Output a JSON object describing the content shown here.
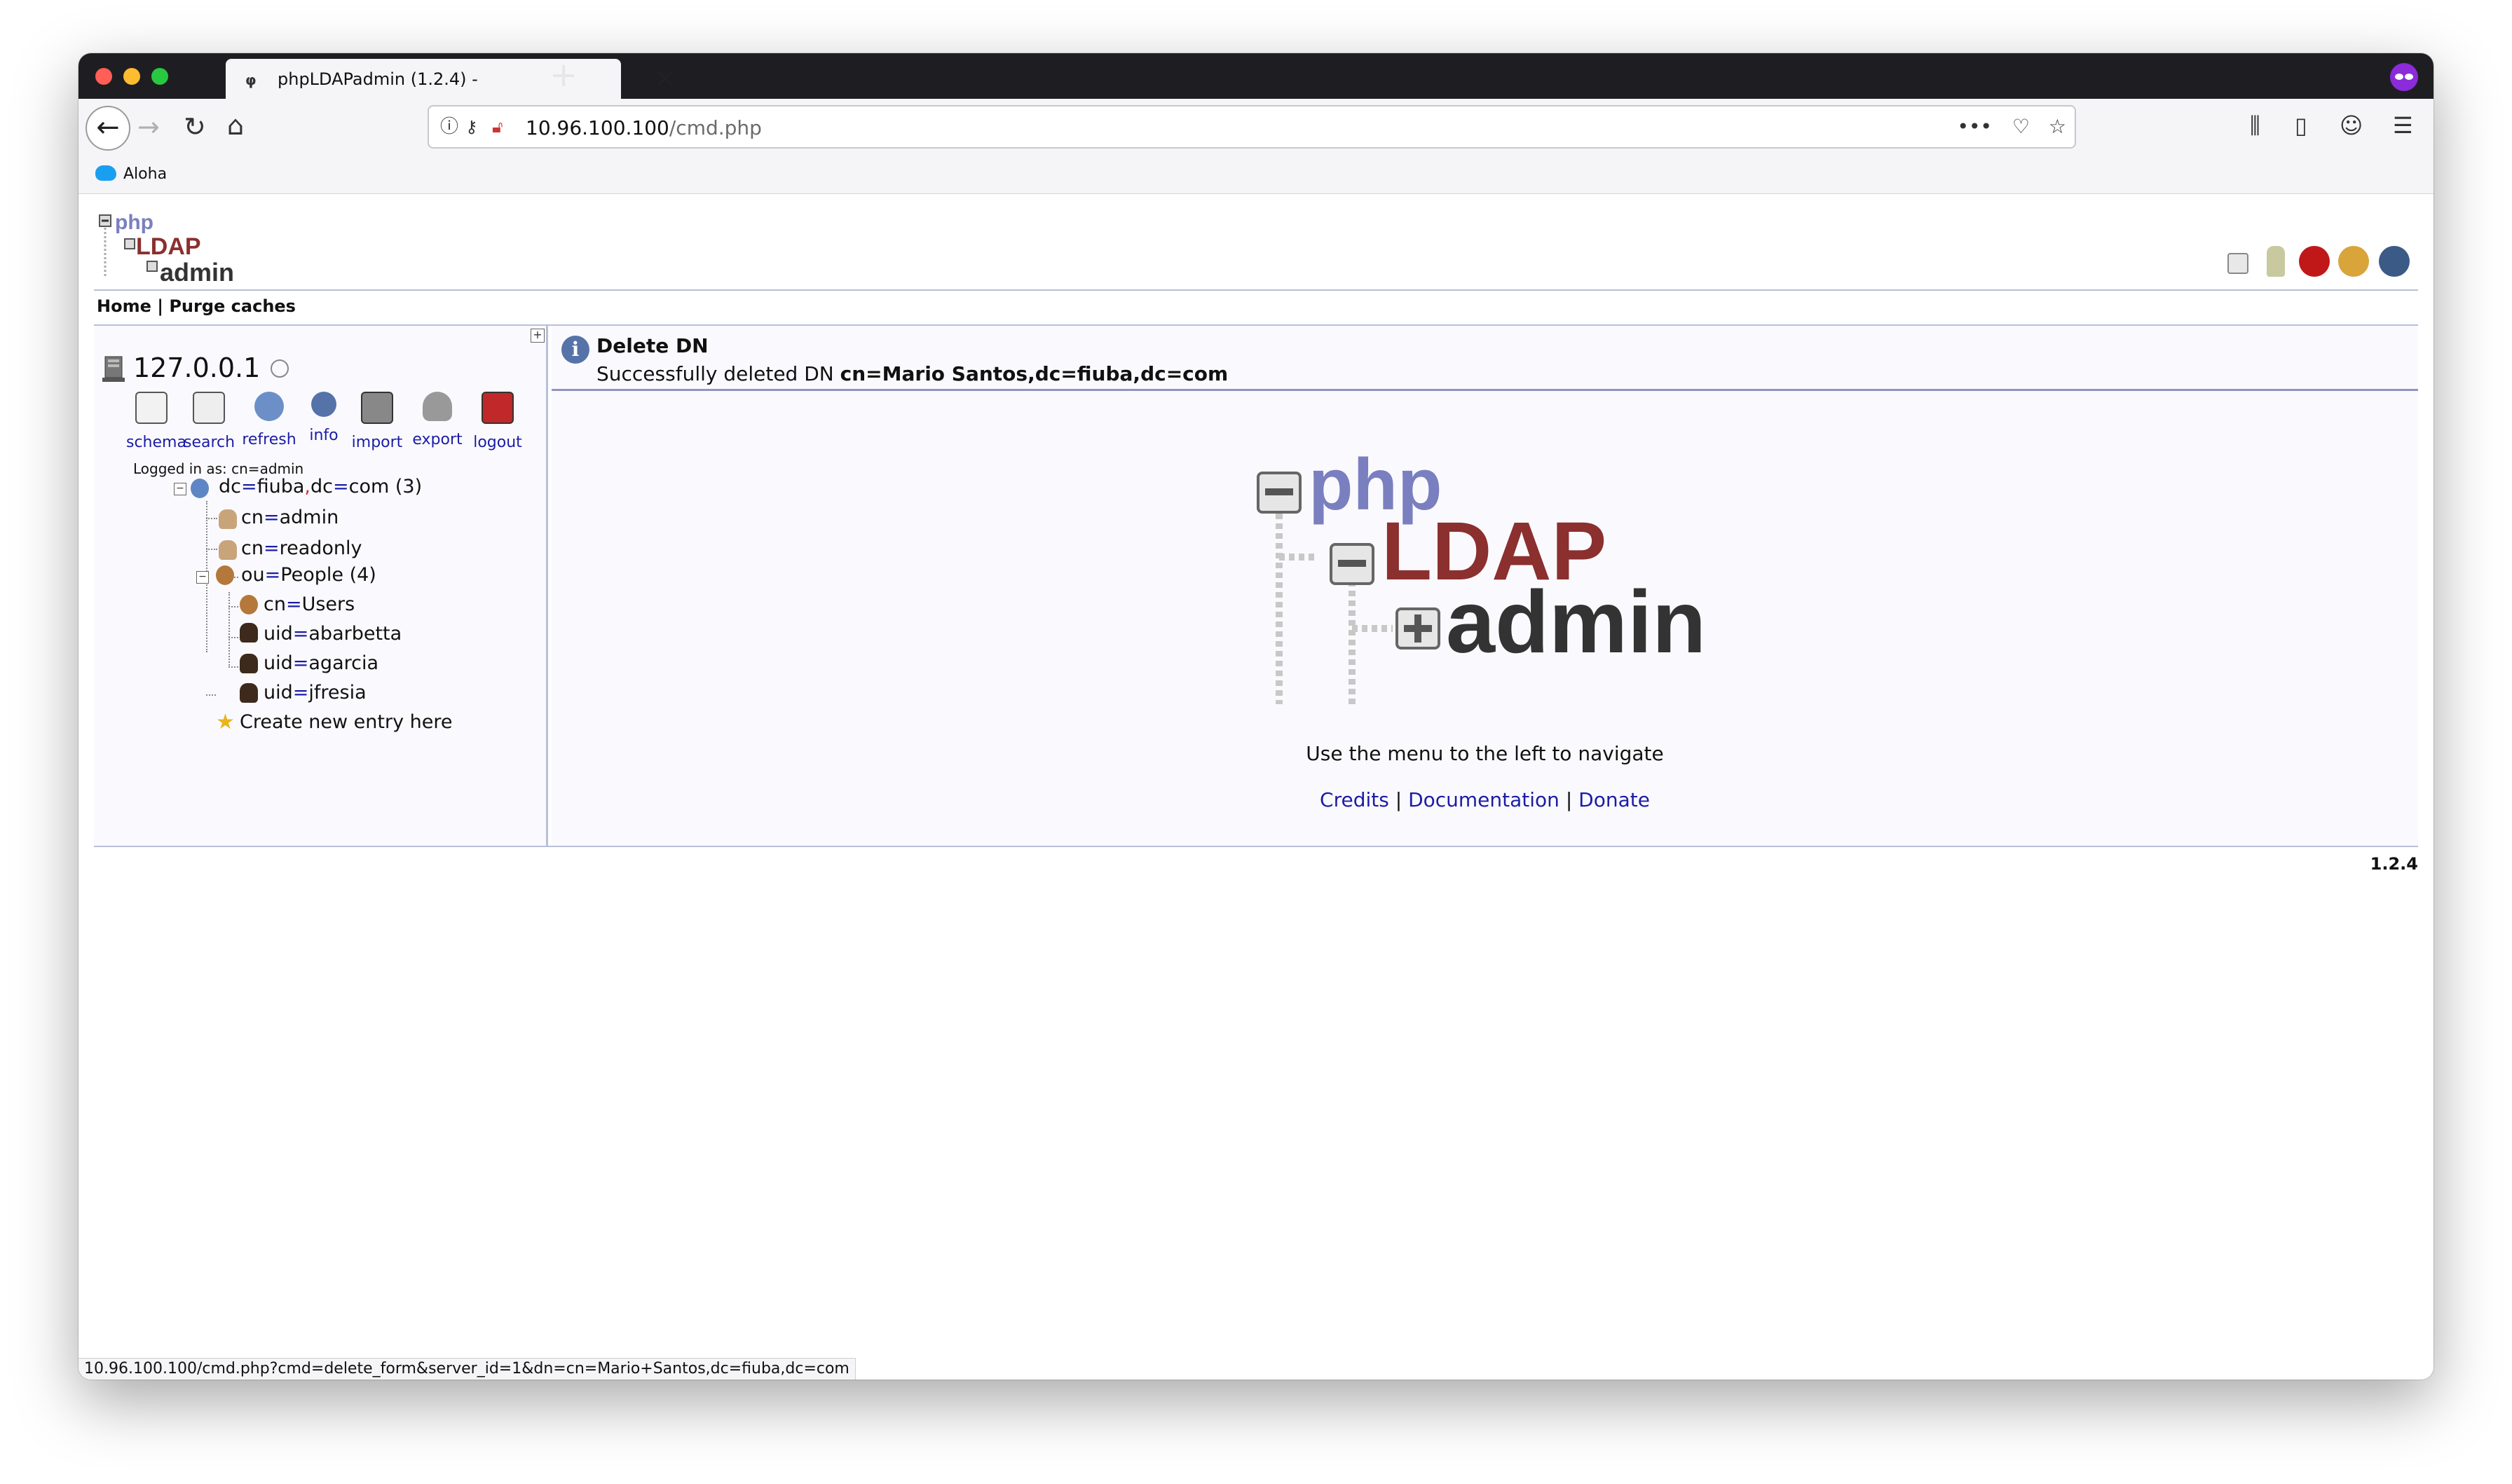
{
  "browser": {
    "tab_title": "phpLDAPadmin (1.2.4) -",
    "url_host": "10.96.100.100",
    "url_path": "/cmd.php",
    "bookmark_label": "Aloha",
    "status_url": "10.96.100.100/cmd.php?cmd=delete_form&server_id=1&dn=cn=Mario+Santos,dc=fiuba,dc=com"
  },
  "app": {
    "logo_text": "phpLDAPadmin",
    "breadcrumbs": {
      "home": "Home",
      "separator": "|",
      "purge": "Purge caches"
    }
  },
  "tree": {
    "server_name": "127.0.0.1",
    "tools": [
      {
        "label": "schema",
        "icon": "schema-icon"
      },
      {
        "label": "search",
        "icon": "search-icon"
      },
      {
        "label": "refresh",
        "icon": "refresh-icon"
      },
      {
        "label": "info",
        "icon": "info-icon"
      },
      {
        "label": "import",
        "icon": "import-icon"
      },
      {
        "label": "export",
        "icon": "export-icon"
      },
      {
        "label": "logout",
        "icon": "logout-icon"
      }
    ],
    "logged_in_as": "Logged in as: cn=admin",
    "root": {
      "k1": "dc",
      "v1": "fiuba",
      "k2": "dc",
      "v2": "com",
      "count": "(3)"
    },
    "entries": [
      {
        "k": "cn",
        "v": "admin"
      },
      {
        "k": "cn",
        "v": "readonly"
      }
    ],
    "ou": {
      "k": "ou",
      "v": "People",
      "count": "(4)"
    },
    "ou_entries": [
      {
        "k": "cn",
        "v": "Users"
      },
      {
        "k": "uid",
        "v": "abarbetta"
      },
      {
        "k": "uid",
        "v": "agarcia"
      },
      {
        "k": "uid",
        "v": "jfresia"
      }
    ],
    "create_entry": "Create new entry here"
  },
  "main": {
    "message_title": "Delete DN",
    "message_prefix": "Successfully deleted DN",
    "message_dn": "cn=Mario Santos,dc=fiuba,dc=com",
    "logo_words": {
      "php": "php",
      "ldap": "LDAP",
      "admin": "admin"
    },
    "navigate_text": "Use the menu to the left to navigate",
    "links": {
      "credits": "Credits",
      "documentation": "Documentation",
      "donate": "Donate",
      "sep": "|"
    },
    "version": "1.2.4"
  },
  "colors": {
    "link": "#1c1ca6",
    "tab_bar": "#1e1e22",
    "logo_php": "#7a7fc0",
    "logo_ldap": "#8b2f2f",
    "logo_admin": "#333333"
  }
}
